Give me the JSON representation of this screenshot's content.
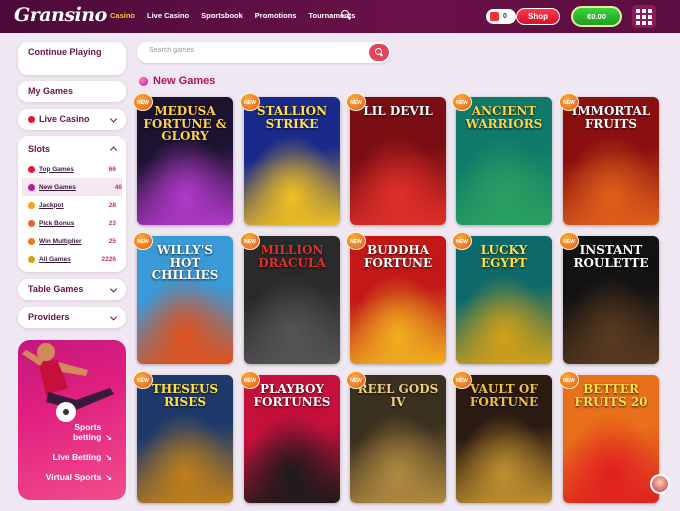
{
  "brand": {
    "logo": "Gransino"
  },
  "nav": [
    "Casino",
    "Live Casino",
    "Sportsbook",
    "Promotions",
    "Tournaments"
  ],
  "header": {
    "bag_count": "0",
    "shop_label": "Shop",
    "balance": "€0.00"
  },
  "sidebar": {
    "continue_playing": "Continue Playing",
    "my_games": "My Games",
    "live_casino": "Live Casino",
    "slots_title": "Slots",
    "slots_items": [
      {
        "label": "Top Games",
        "count": "66",
        "color": "#e0192d"
      },
      {
        "label": "New Games",
        "count": "46",
        "color": "#c2188f"
      },
      {
        "label": "Jackpot",
        "count": "28",
        "color": "#f2a21c"
      },
      {
        "label": "Pick Bonus",
        "count": "23",
        "color": "#e8622a"
      },
      {
        "label": "Win Multiplier",
        "count": "25",
        "color": "#f07a1a"
      },
      {
        "label": "All Games",
        "count": "2226",
        "color": "#d4a017"
      }
    ],
    "table_games": "Table Games",
    "providers": "Providers"
  },
  "promo": {
    "sports_betting": "Sports betting",
    "live_betting": "Live Betting",
    "virtual_sports": "Virtual Sports"
  },
  "search": {
    "placeholder": "Search games"
  },
  "section": {
    "title": "New Games"
  },
  "new_badge": "NEW",
  "games": [
    {
      "title": "MEDUSA FORTUNE & GLORY",
      "bg": "#1c1330",
      "accent": "#b03ac8",
      "text": "#ffd24a"
    },
    {
      "title": "STALLION STRIKE",
      "bg": "#1a2a8a",
      "accent": "#f0c020",
      "text": "#ffe04a"
    },
    {
      "title": "LIL DEVIL",
      "bg": "#7a0e12",
      "accent": "#e0302a",
      "text": "#ffffff"
    },
    {
      "title": "ANCIENT WARRIORS",
      "bg": "#0f7a6a",
      "accent": "#2aa060",
      "text": "#ffd24a"
    },
    {
      "title": "IMMORTAL FRUITS",
      "bg": "#8a1010",
      "accent": "#e0601a",
      "text": "#ffffff"
    },
    {
      "title": "WILLY'S HOT CHILLIES",
      "bg": "#3a9ad8",
      "accent": "#e0501a",
      "text": "#ffffff"
    },
    {
      "title": "MILLION DRACULA",
      "bg": "#2a2a2a",
      "accent": "#555555",
      "text": "#e0302a"
    },
    {
      "title": "BUDDHA FORTUNE",
      "bg": "#c21818",
      "accent": "#f0b020",
      "text": "#ffffff"
    },
    {
      "title": "LUCKY EGYPT",
      "bg": "#0e6a6a",
      "accent": "#d4a017",
      "text": "#ffe04a"
    },
    {
      "title": "INSTANT ROULETTE",
      "bg": "#121212",
      "accent": "#5a3a20",
      "text": "#ffffff"
    },
    {
      "title": "THESEUS RISES",
      "bg": "#1f3a6a",
      "accent": "#c0801a",
      "text": "#ffe04a"
    },
    {
      "title": "PLAYBOY FORTUNES",
      "bg": "#c4103a",
      "accent": "#1a1a1a",
      "text": "#ffffff"
    },
    {
      "title": "REEL GODS IV",
      "bg": "#3a3020",
      "accent": "#b08a40",
      "text": "#f0d080"
    },
    {
      "title": "VAULT OF FORTUNE",
      "bg": "#2a1a12",
      "accent": "#c09030",
      "text": "#f0c040"
    },
    {
      "title": "BETTER FRUITS 20",
      "bg": "#e8701a",
      "accent": "#e02020",
      "text": "#ffe04a"
    }
  ]
}
